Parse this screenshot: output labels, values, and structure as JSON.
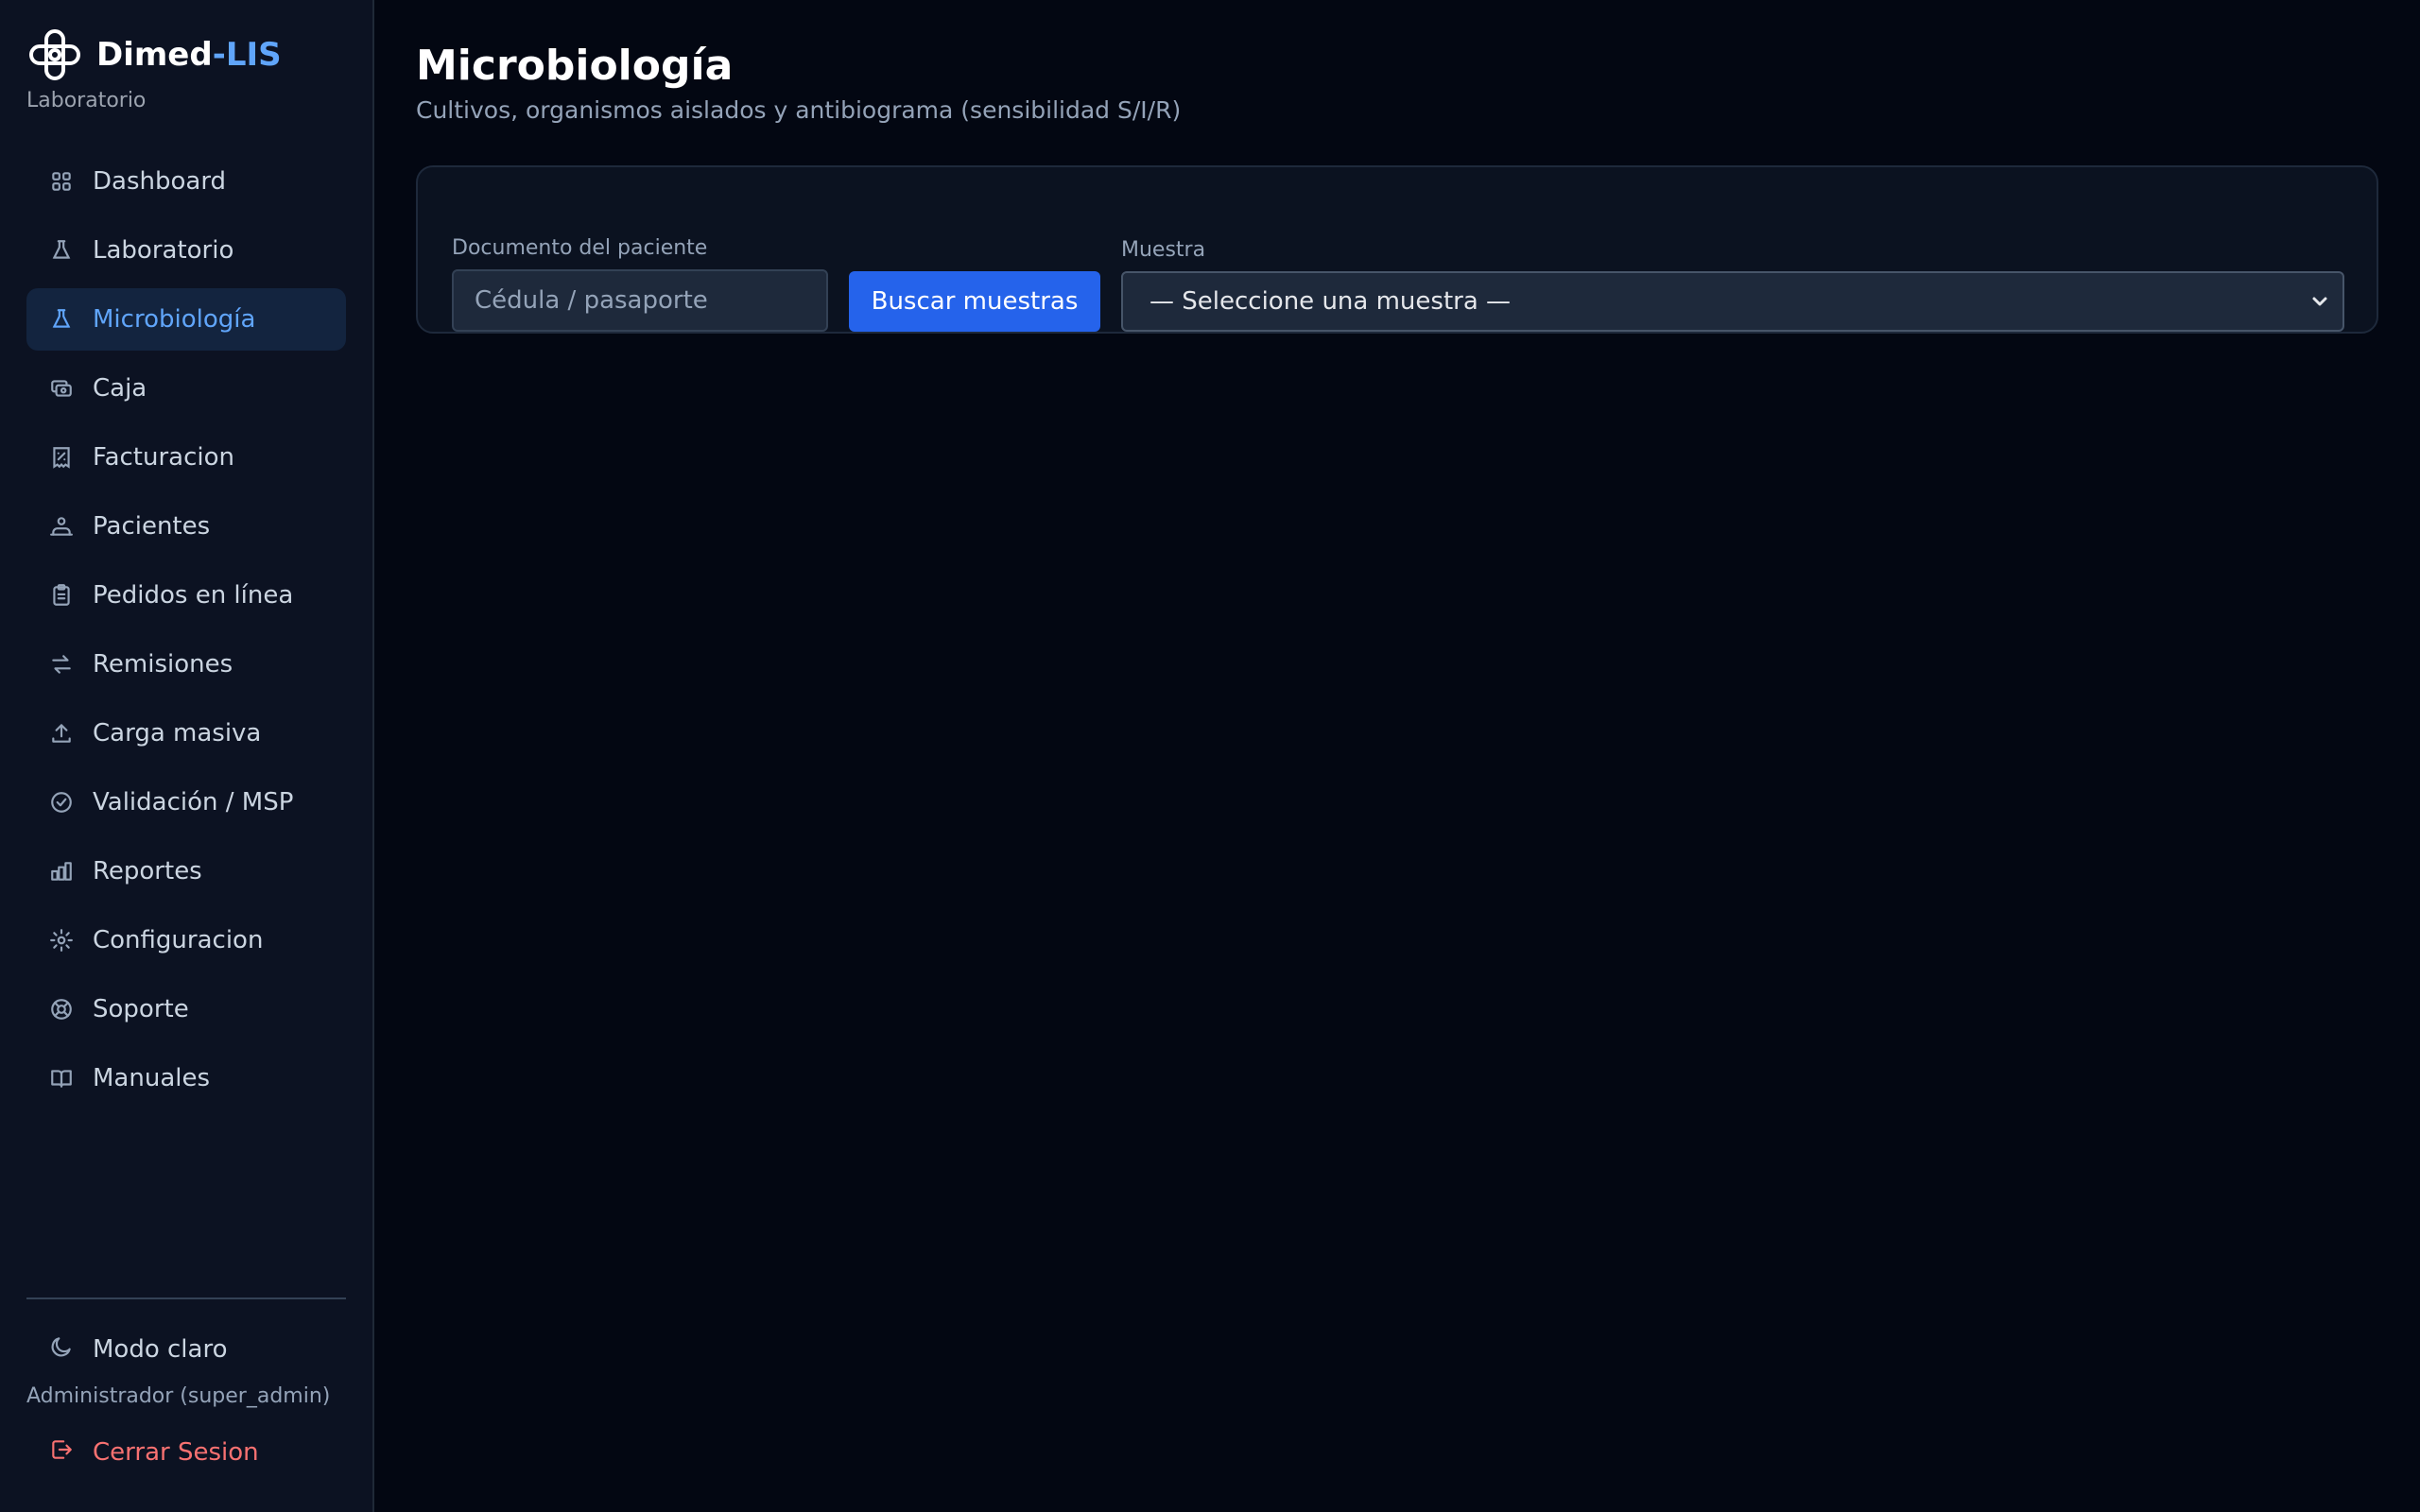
{
  "brand": {
    "name": "Dimed",
    "accent": "-LIS",
    "subtitle": "Laboratorio"
  },
  "sidebar": {
    "items": [
      {
        "label": "Dashboard",
        "icon": "grid-icon"
      },
      {
        "label": "Laboratorio",
        "icon": "flask-icon"
      },
      {
        "label": "Microbiología",
        "icon": "flask-icon",
        "active": true
      },
      {
        "label": "Caja",
        "icon": "cash-icon"
      },
      {
        "label": "Facturacion",
        "icon": "receipt-icon"
      },
      {
        "label": "Pacientes",
        "icon": "users-icon"
      },
      {
        "label": "Pedidos en línea",
        "icon": "clipboard-icon"
      },
      {
        "label": "Remisiones",
        "icon": "arrows-exchange-icon"
      },
      {
        "label": "Carga masiva",
        "icon": "upload-icon"
      },
      {
        "label": "Validación / MSP",
        "icon": "check-circle-icon"
      },
      {
        "label": "Reportes",
        "icon": "bar-chart-icon"
      },
      {
        "label": "Configuracion",
        "icon": "gear-icon"
      },
      {
        "label": "Soporte",
        "icon": "lifebuoy-icon"
      },
      {
        "label": "Manuales",
        "icon": "book-icon"
      }
    ],
    "mode_toggle": "Modo claro",
    "user": "Administrador (super_admin)",
    "logout": "Cerrar Sesion"
  },
  "main": {
    "title": "Microbiología",
    "subtitle": "Cultivos, organismos aislados y antibiograma (sensibilidad S/I/R)",
    "form": {
      "document_label": "Documento del paciente",
      "document_placeholder": "Cédula / pasaporte",
      "document_value": "",
      "search_button": "Buscar muestras",
      "sample_label": "Muestra",
      "sample_selected": "— Seleccione una muestra —"
    }
  },
  "colors": {
    "accent": "#60a5fa",
    "primary_button": "#2563eb",
    "danger": "#f87171",
    "background": "#030712",
    "sidebar": "#0c1222"
  }
}
